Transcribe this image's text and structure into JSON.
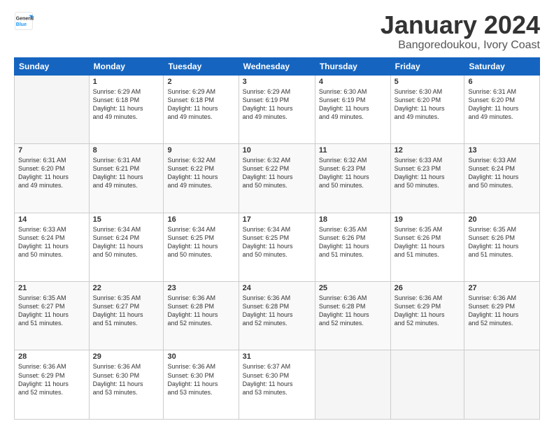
{
  "header": {
    "logo_general": "General",
    "logo_blue": "Blue",
    "month": "January 2024",
    "location": "Bangoredoukou, Ivory Coast"
  },
  "weekdays": [
    "Sunday",
    "Monday",
    "Tuesday",
    "Wednesday",
    "Thursday",
    "Friday",
    "Saturday"
  ],
  "weeks": [
    [
      {
        "day": "",
        "info": ""
      },
      {
        "day": "1",
        "info": "Sunrise: 6:29 AM\nSunset: 6:18 PM\nDaylight: 11 hours\nand 49 minutes."
      },
      {
        "day": "2",
        "info": "Sunrise: 6:29 AM\nSunset: 6:18 PM\nDaylight: 11 hours\nand 49 minutes."
      },
      {
        "day": "3",
        "info": "Sunrise: 6:29 AM\nSunset: 6:19 PM\nDaylight: 11 hours\nand 49 minutes."
      },
      {
        "day": "4",
        "info": "Sunrise: 6:30 AM\nSunset: 6:19 PM\nDaylight: 11 hours\nand 49 minutes."
      },
      {
        "day": "5",
        "info": "Sunrise: 6:30 AM\nSunset: 6:20 PM\nDaylight: 11 hours\nand 49 minutes."
      },
      {
        "day": "6",
        "info": "Sunrise: 6:31 AM\nSunset: 6:20 PM\nDaylight: 11 hours\nand 49 minutes."
      }
    ],
    [
      {
        "day": "7",
        "info": "Sunrise: 6:31 AM\nSunset: 6:20 PM\nDaylight: 11 hours\nand 49 minutes."
      },
      {
        "day": "8",
        "info": "Sunrise: 6:31 AM\nSunset: 6:21 PM\nDaylight: 11 hours\nand 49 minutes."
      },
      {
        "day": "9",
        "info": "Sunrise: 6:32 AM\nSunset: 6:22 PM\nDaylight: 11 hours\nand 49 minutes."
      },
      {
        "day": "10",
        "info": "Sunrise: 6:32 AM\nSunset: 6:22 PM\nDaylight: 11 hours\nand 50 minutes."
      },
      {
        "day": "11",
        "info": "Sunrise: 6:32 AM\nSunset: 6:23 PM\nDaylight: 11 hours\nand 50 minutes."
      },
      {
        "day": "12",
        "info": "Sunrise: 6:33 AM\nSunset: 6:23 PM\nDaylight: 11 hours\nand 50 minutes."
      },
      {
        "day": "13",
        "info": "Sunrise: 6:33 AM\nSunset: 6:24 PM\nDaylight: 11 hours\nand 50 minutes."
      }
    ],
    [
      {
        "day": "14",
        "info": "Sunrise: 6:33 AM\nSunset: 6:24 PM\nDaylight: 11 hours\nand 50 minutes."
      },
      {
        "day": "15",
        "info": "Sunrise: 6:34 AM\nSunset: 6:24 PM\nDaylight: 11 hours\nand 50 minutes."
      },
      {
        "day": "16",
        "info": "Sunrise: 6:34 AM\nSunset: 6:25 PM\nDaylight: 11 hours\nand 50 minutes."
      },
      {
        "day": "17",
        "info": "Sunrise: 6:34 AM\nSunset: 6:25 PM\nDaylight: 11 hours\nand 50 minutes."
      },
      {
        "day": "18",
        "info": "Sunrise: 6:35 AM\nSunset: 6:26 PM\nDaylight: 11 hours\nand 51 minutes."
      },
      {
        "day": "19",
        "info": "Sunrise: 6:35 AM\nSunset: 6:26 PM\nDaylight: 11 hours\nand 51 minutes."
      },
      {
        "day": "20",
        "info": "Sunrise: 6:35 AM\nSunset: 6:26 PM\nDaylight: 11 hours\nand 51 minutes."
      }
    ],
    [
      {
        "day": "21",
        "info": "Sunrise: 6:35 AM\nSunset: 6:27 PM\nDaylight: 11 hours\nand 51 minutes."
      },
      {
        "day": "22",
        "info": "Sunrise: 6:35 AM\nSunset: 6:27 PM\nDaylight: 11 hours\nand 51 minutes."
      },
      {
        "day": "23",
        "info": "Sunrise: 6:36 AM\nSunset: 6:28 PM\nDaylight: 11 hours\nand 52 minutes."
      },
      {
        "day": "24",
        "info": "Sunrise: 6:36 AM\nSunset: 6:28 PM\nDaylight: 11 hours\nand 52 minutes."
      },
      {
        "day": "25",
        "info": "Sunrise: 6:36 AM\nSunset: 6:28 PM\nDaylight: 11 hours\nand 52 minutes."
      },
      {
        "day": "26",
        "info": "Sunrise: 6:36 AM\nSunset: 6:29 PM\nDaylight: 11 hours\nand 52 minutes."
      },
      {
        "day": "27",
        "info": "Sunrise: 6:36 AM\nSunset: 6:29 PM\nDaylight: 11 hours\nand 52 minutes."
      }
    ],
    [
      {
        "day": "28",
        "info": "Sunrise: 6:36 AM\nSunset: 6:29 PM\nDaylight: 11 hours\nand 52 minutes."
      },
      {
        "day": "29",
        "info": "Sunrise: 6:36 AM\nSunset: 6:30 PM\nDaylight: 11 hours\nand 53 minutes."
      },
      {
        "day": "30",
        "info": "Sunrise: 6:36 AM\nSunset: 6:30 PM\nDaylight: 11 hours\nand 53 minutes."
      },
      {
        "day": "31",
        "info": "Sunrise: 6:37 AM\nSunset: 6:30 PM\nDaylight: 11 hours\nand 53 minutes."
      },
      {
        "day": "",
        "info": ""
      },
      {
        "day": "",
        "info": ""
      },
      {
        "day": "",
        "info": ""
      }
    ]
  ]
}
